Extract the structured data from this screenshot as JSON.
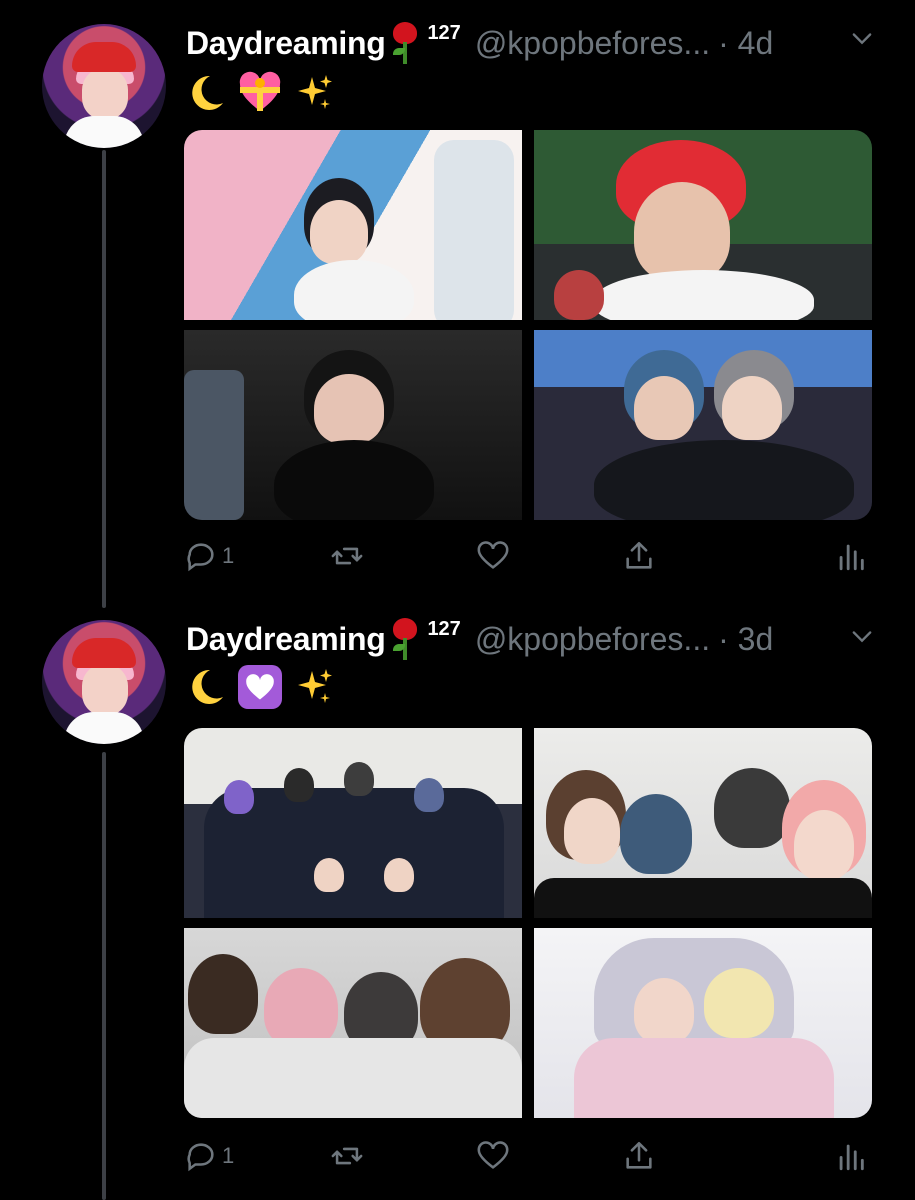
{
  "tweets": [
    {
      "name": "Daydreaming",
      "badge": "127",
      "handle": "@kpopbefores...",
      "time": "· 4d",
      "emoji": [
        "crescent-moon",
        "heart-with-ribbon",
        "sparkles"
      ],
      "replies": "1",
      "photos": [
        "photo-1",
        "photo-2",
        "photo-3",
        "photo-4"
      ]
    },
    {
      "name": "Daydreaming",
      "badge": "127",
      "handle": "@kpopbefores...",
      "time": "· 3d",
      "emoji": [
        "crescent-moon",
        "purple-heart",
        "sparkles"
      ],
      "replies": "1",
      "photos": [
        "photo-1",
        "photo-2",
        "photo-3",
        "photo-4"
      ]
    }
  ],
  "colors": {
    "background": "#000000",
    "muted": "#6e767d",
    "thread_line": "#3d4046"
  }
}
